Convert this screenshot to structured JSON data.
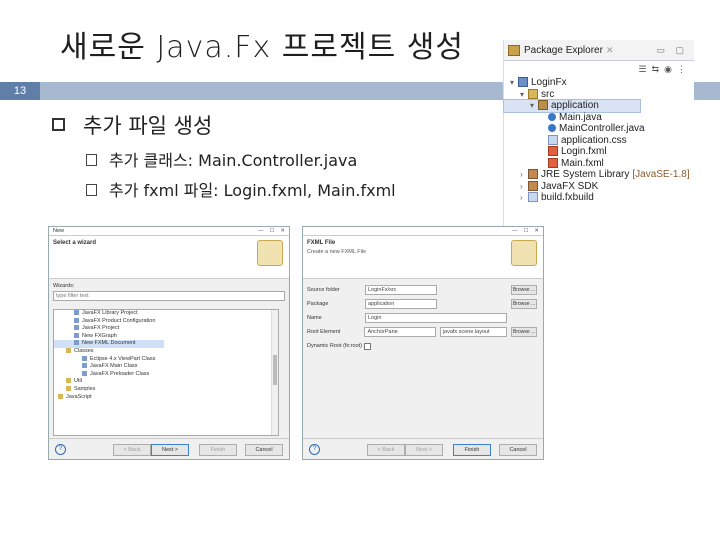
{
  "slide": {
    "title": "새로운 Java.Fx 프로젝트 생성",
    "number": "13",
    "bullet_main": "추가 파일 생성",
    "sub_bullets": [
      "추가 클래스: Main.Controller.java",
      "추가 fxml 파일: Login.fxml, Main.fxml"
    ]
  },
  "package_explorer": {
    "title": "Package Explorer",
    "tree": [
      {
        "label": "LoginFx",
        "icon": "project-icon",
        "expanded": true,
        "depth": 0
      },
      {
        "label": "src",
        "icon": "source-folder-icon",
        "expanded": true,
        "depth": 1
      },
      {
        "label": "application",
        "icon": "package-icon",
        "expanded": true,
        "depth": 2,
        "selected": true
      },
      {
        "label": "Main.java",
        "icon": "java-file-icon",
        "depth": 3
      },
      {
        "label": "MainController.java",
        "icon": "java-file-icon",
        "depth": 3
      },
      {
        "label": "application.css",
        "icon": "css-file-icon",
        "depth": 3
      },
      {
        "label": "Login.fxml",
        "icon": "fxml-file-icon",
        "depth": 3
      },
      {
        "label": "Main.fxml",
        "icon": "fxml-file-icon",
        "depth": 3
      },
      {
        "label": "JRE System Library",
        "suffix": "[JavaSE-1.8]",
        "icon": "library-icon",
        "depth": 1
      },
      {
        "label": "JavaFX SDK",
        "icon": "library-icon",
        "depth": 1
      },
      {
        "label": "build.fxbuild",
        "icon": "file-icon",
        "depth": 1
      }
    ]
  },
  "wizard_new": {
    "window_title": "New",
    "heading": "Select a wizard",
    "wizards_label": "Wizards:",
    "filter_placeholder": "type filter text",
    "items": [
      {
        "label": "JavaFX Library Project",
        "indent": 2
      },
      {
        "label": "JavaFX Product Configuration",
        "indent": 2
      },
      {
        "label": "JavaFX Project",
        "indent": 2
      },
      {
        "label": "New FXGraph",
        "indent": 2
      },
      {
        "label": "New FXML Document",
        "indent": 2,
        "selected": true
      },
      {
        "label": "Classes",
        "indent": 1
      },
      {
        "label": "Eclipse 4.x ViewPart Class",
        "indent": 3
      },
      {
        "label": "JavaFX Main Class",
        "indent": 3
      },
      {
        "label": "JavaFX Preloader Class",
        "indent": 3
      },
      {
        "label": "Util",
        "indent": 1
      },
      {
        "label": "Samples",
        "indent": 1
      },
      {
        "label": "JavaScript",
        "indent": 0
      }
    ],
    "buttons": {
      "help": "?",
      "back": "< Back",
      "next": "Next >",
      "finish": "Finish",
      "cancel": "Cancel"
    }
  },
  "wizard_fxml": {
    "window_title": "",
    "heading": "FXML File",
    "description": "Create a new FXML File",
    "fields": {
      "source_folder_label": "Source folder",
      "source_folder_value": "LoginFx/src",
      "package_label": "Package",
      "package_value": "application",
      "name_label": "Name",
      "name_value": "Login",
      "root_element_label": "Root Element",
      "root_element_value": "AnchorPane",
      "root_element_type": "javafx.scene.layout",
      "dynamic_root_label": "Dynamic Root (fx:root)",
      "browse": "Browse ..."
    },
    "buttons": {
      "help": "?",
      "back": "< Back",
      "next": "Next >",
      "finish": "Finish",
      "cancel": "Cancel"
    }
  }
}
